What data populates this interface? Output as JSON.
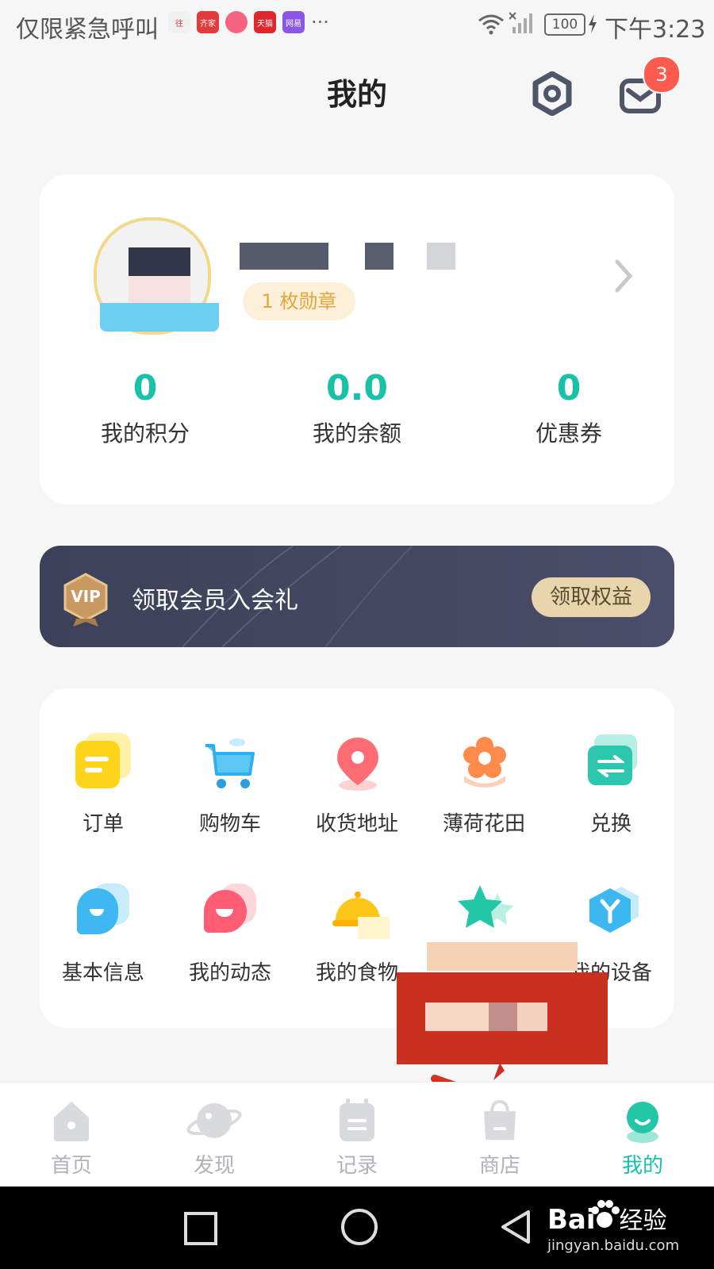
{
  "status_bar": {
    "carrier": "仅限紧急呼叫",
    "apps": [
      "往",
      "齐家",
      "",
      "天猫",
      "网易"
    ],
    "more": "···",
    "battery": "100",
    "time": "下午3:23"
  },
  "header": {
    "title": "我的",
    "message_badge": "3"
  },
  "profile": {
    "badge_count_label": "1 枚勋章",
    "stats": [
      {
        "value": "0",
        "label": "我的积分"
      },
      {
        "value": "0.0",
        "label": "我的余额"
      },
      {
        "value": "0",
        "label": "优惠券"
      }
    ]
  },
  "vip": {
    "icon_text": "VIP",
    "text": "领取会员入会礼",
    "button": "领取权益"
  },
  "grid": {
    "row1": [
      "订单",
      "购物车",
      "收货地址",
      "薄荷花田",
      "兑换"
    ],
    "row2": [
      "基本信息",
      "我的动态",
      "我的食物",
      "",
      "我的设备"
    ]
  },
  "tabbar": {
    "items": [
      "首页",
      "发现",
      "记录",
      "商店",
      "我的"
    ],
    "active_index": 4
  },
  "watermark": {
    "brand": "Bai",
    "brand2": "经验",
    "url": "jingyan.baidu.com"
  },
  "colors": {
    "accent": "#18c1a8",
    "vip_bg": "#454862",
    "vip_button": "#e9d5ac",
    "badge_bg": "#fdf0d8",
    "badge_text": "#e8a33a",
    "notification": "#ff5a4e",
    "annotation_red": "#c9301f"
  }
}
